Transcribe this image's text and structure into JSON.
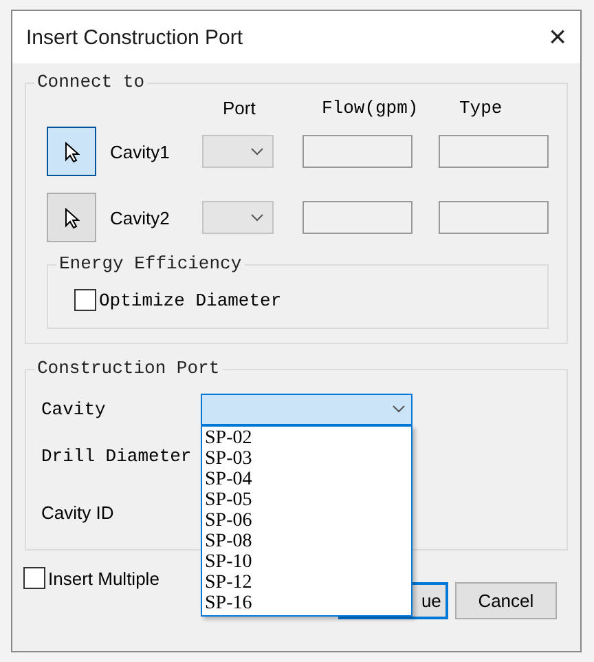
{
  "window": {
    "title": "Insert Construction Port",
    "close": "×"
  },
  "connect_to": {
    "legend": "Connect to",
    "columns": [
      "Port",
      "Flow(gpm)",
      "Type"
    ],
    "rows": [
      {
        "label": "Cavity1",
        "selected": true
      },
      {
        "label": "Cavity2",
        "selected": false
      }
    ],
    "energy_efficiency": {
      "legend": "Energy Efficiency",
      "checkbox": {
        "label": "Optimize Diameter",
        "checked": false
      }
    }
  },
  "construction_port": {
    "legend": "Construction Port",
    "fields": [
      {
        "label": "Cavity",
        "kind": "dropdown",
        "open": true,
        "options": [
          "SP-02",
          "SP-03",
          "SP-04",
          "SP-05",
          "SP-06",
          "SP-08",
          "SP-10",
          "SP-12",
          "SP-16"
        ]
      },
      {
        "label": "Drill Diameter",
        "kind": "hidden"
      },
      {
        "label": "Cavity ID",
        "kind": "hidden",
        "sans": true
      }
    ]
  },
  "insert_multiple": {
    "label": "Insert Multiple",
    "checked": false
  },
  "buttons": [
    {
      "label": "ue",
      "default": true
    },
    {
      "label": "Cancel",
      "default": false
    }
  ]
}
